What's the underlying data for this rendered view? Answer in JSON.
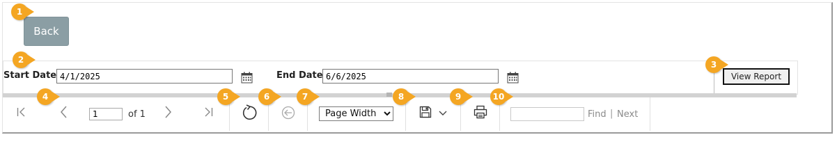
{
  "back_button": {
    "label": "Back"
  },
  "parameters": {
    "start_label": "Start Date",
    "start_value": "4/1/2025",
    "end_label": "End Date",
    "end_value": "6/6/2025",
    "view_report_label": "View Report"
  },
  "toolbar": {
    "page_current": "1",
    "page_of": "of 1",
    "zoom_selected": "Page Width",
    "find_label": "Find",
    "separator": "|",
    "next_label": "Next"
  },
  "callouts": [
    "1",
    "2",
    "3",
    "4",
    "5",
    "6",
    "7",
    "8",
    "9",
    "10"
  ],
  "colors": {
    "callout": "#f4a623",
    "back_button": "#8b9ea4"
  }
}
